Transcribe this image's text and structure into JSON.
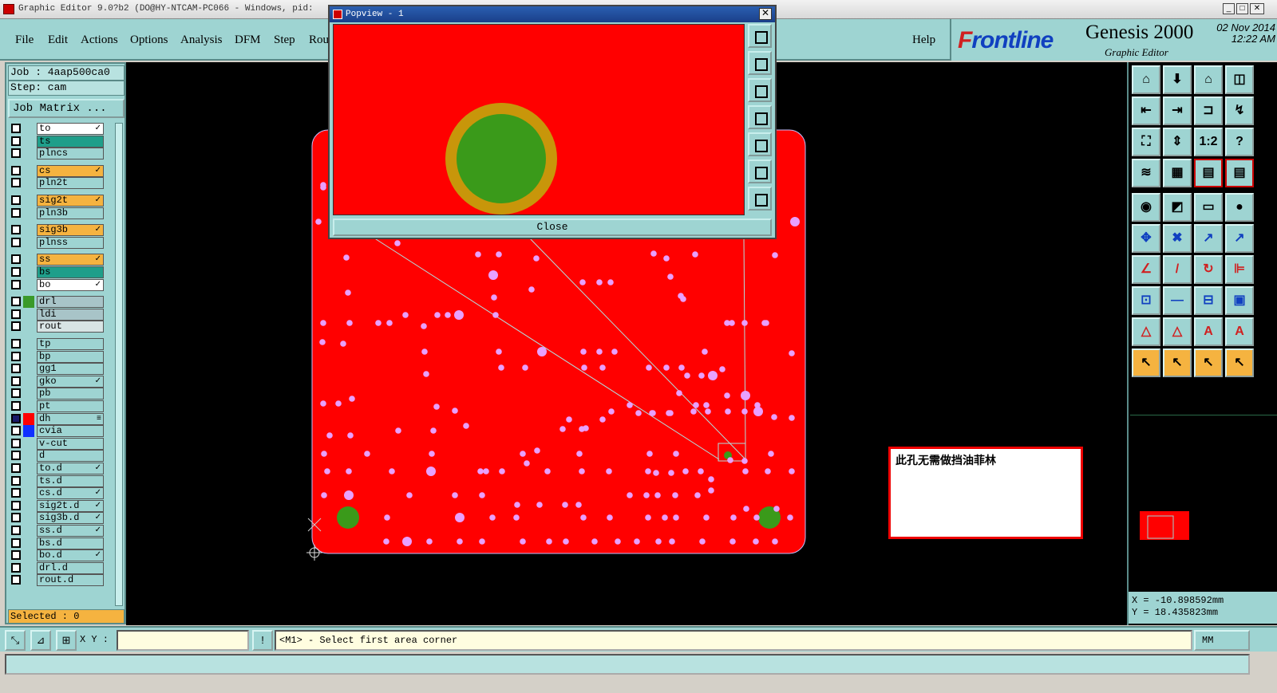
{
  "window": {
    "title": "Graphic Editor 9.0?b2 (DO@HY-NTCAM-PC066 - Windows, pid:",
    "min": "_",
    "max": "□",
    "close": "✕"
  },
  "menu": {
    "items": [
      "File",
      "Edit",
      "Actions",
      "Options",
      "Analysis",
      "DFM",
      "Step",
      "Rou"
    ],
    "help": "Help"
  },
  "brand": {
    "logo_prefix": "F",
    "logo": "rontline",
    "product": "Genesis 2000",
    "subtitle": "Graphic Editor",
    "date": "02 Nov 2014",
    "time": "12:22 AM"
  },
  "job": {
    "job_line": "Job : 4aap500ca0",
    "step_line": "Step: cam",
    "matrix_button": "Job Matrix ..."
  },
  "layers": [
    {
      "name": "to",
      "style": "w",
      "color": "",
      "mark": "✓"
    },
    {
      "name": "ts",
      "style": "g",
      "color": "",
      "mark": ""
    },
    {
      "name": "plncs",
      "style": "",
      "color": "",
      "mark": ""
    },
    {
      "name": "cs",
      "style": "o",
      "color": "",
      "mark": "✓"
    },
    {
      "name": "pln2t",
      "style": "",
      "color": "",
      "mark": ""
    },
    {
      "name": "sig2t",
      "style": "o",
      "color": "",
      "mark": "✓"
    },
    {
      "name": "pln3b",
      "style": "",
      "color": "",
      "mark": ""
    },
    {
      "name": "sig3b",
      "style": "o",
      "color": "",
      "mark": "✓"
    },
    {
      "name": "plnss",
      "style": "",
      "color": "",
      "mark": ""
    },
    {
      "name": "ss",
      "style": "o",
      "color": "",
      "mark": "✓"
    },
    {
      "name": "bs",
      "style": "g",
      "color": "",
      "mark": ""
    },
    {
      "name": "bo",
      "style": "w",
      "color": "",
      "mark": "✓"
    },
    {
      "name": "drl",
      "style": "gr",
      "color": "#3a9a2a",
      "mark": ""
    },
    {
      "name": "ldi",
      "style": "gr",
      "color": "",
      "mark": ""
    },
    {
      "name": "rout",
      "style": "lg",
      "color": "",
      "mark": ""
    },
    {
      "name": "tp",
      "style": "",
      "color": "",
      "mark": ""
    },
    {
      "name": "bp",
      "style": "",
      "color": "",
      "mark": ""
    },
    {
      "name": "gg1",
      "style": "",
      "color": "",
      "mark": ""
    },
    {
      "name": "gko",
      "style": "",
      "color": "",
      "mark": "✓"
    },
    {
      "name": "pb",
      "style": "",
      "color": "",
      "mark": ""
    },
    {
      "name": "pt",
      "style": "",
      "color": "",
      "mark": ""
    },
    {
      "name": "dh",
      "style": "",
      "color": "#ff0000",
      "mark": "≡",
      "blk": true
    },
    {
      "name": "cvia",
      "style": "",
      "color": "#1030ff",
      "mark": ""
    },
    {
      "name": "v-cut",
      "style": "",
      "color": "",
      "mark": ""
    },
    {
      "name": "d",
      "style": "",
      "color": "",
      "mark": ""
    },
    {
      "name": "to.d",
      "style": "",
      "color": "",
      "mark": "✓"
    },
    {
      "name": "ts.d",
      "style": "",
      "color": "",
      "mark": ""
    },
    {
      "name": "cs.d",
      "style": "",
      "color": "",
      "mark": "✓"
    },
    {
      "name": "sig2t.d",
      "style": "",
      "color": "",
      "mark": "✓"
    },
    {
      "name": "sig3b.d",
      "style": "",
      "color": "",
      "mark": "✓"
    },
    {
      "name": "ss.d",
      "style": "",
      "color": "",
      "mark": "✓"
    },
    {
      "name": "bs.d",
      "style": "",
      "color": "",
      "mark": ""
    },
    {
      "name": "bo.d",
      "style": "",
      "color": "",
      "mark": "✓"
    },
    {
      "name": "drl.d",
      "style": "",
      "color": "",
      "mark": ""
    },
    {
      "name": "rout.d",
      "style": "",
      "color": "",
      "mark": ""
    }
  ],
  "selected": "Selected : 0",
  "popview": {
    "title": "Popview - 1",
    "close_button": "Close"
  },
  "note": {
    "text": "此孔无需做挡油菲林"
  },
  "coords": {
    "x": "X = -10.898592mm",
    "y": "Y = 18.435823mm"
  },
  "bottom": {
    "xy_label": "X Y :",
    "xy_value": "",
    "alert_icon": "!",
    "message": "<M1> - Select first area corner",
    "unit": "MM"
  },
  "colors": {
    "panel": "#9ed4d2",
    "board": "#ff0000",
    "via": "#e8a0ff",
    "pad": "#3a9a1a",
    "ring": "#c8960a"
  }
}
